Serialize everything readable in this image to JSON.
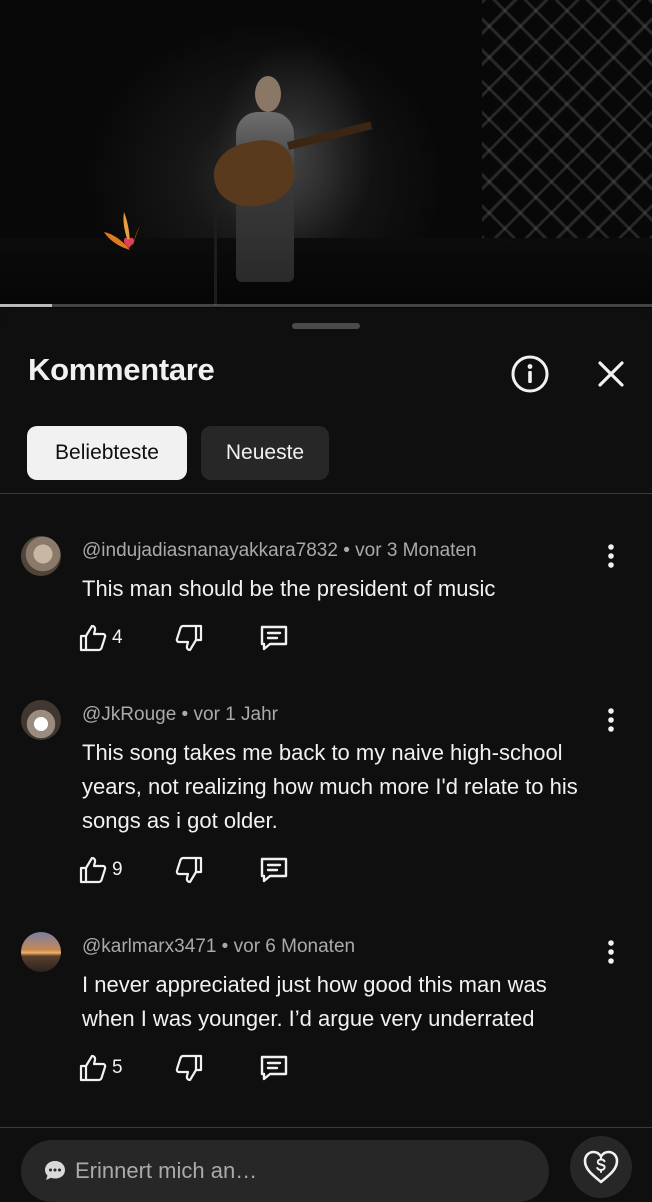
{
  "video": {
    "progress_fraction": 0.08
  },
  "comments_panel": {
    "title": "Kommentare",
    "info_icon": "info-icon",
    "close_icon": "close-icon",
    "sort_chips": [
      {
        "label": "Beliebteste",
        "selected": true
      },
      {
        "label": "Neueste",
        "selected": false
      }
    ]
  },
  "comments": [
    {
      "author": "@indujadiasnanayakkara7832",
      "time": "vor 3 Monaten",
      "text": "This man should be the president of music",
      "likes": "4"
    },
    {
      "author": "@JkRouge",
      "time": "vor 1 Jahr",
      "text": "This song takes me back to my naive high-school years, not realizing how much more I'd relate to his songs as i got older.",
      "likes": "9"
    },
    {
      "author": "@karlmarx3471",
      "time": "vor 6 Monaten",
      "text": "I never appreciated just how good this man was when I was younger. I’d argue very underrated",
      "likes": "5"
    }
  ],
  "meta_separator": " • ",
  "composer": {
    "placeholder": "Erinnert mich an…",
    "emoji_icon": "speech-bubble-emoji-icon",
    "thanks_icon": "heart-dollar-icon"
  },
  "colors": {
    "background": "#0f0f0f",
    "text_primary": "#f1f1f1",
    "text_secondary": "#aaaaaa",
    "chip_inactive": "#272727",
    "chip_active": "#f1f1f1"
  }
}
